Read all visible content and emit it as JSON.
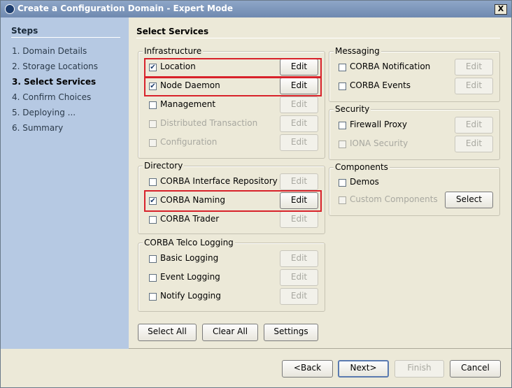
{
  "window": {
    "title": "Create a Configuration Domain - Expert Mode",
    "close_label": "X"
  },
  "steps": {
    "title": "Steps",
    "items": [
      "1. Domain Details",
      "2. Storage Locations",
      "3. Select Services",
      "4. Confirm Choices",
      "5. Deploying ...",
      "6. Summary"
    ]
  },
  "content": {
    "title": "Select Services"
  },
  "infrastructure": {
    "label": "Infrastructure",
    "items": [
      {
        "label": "Location",
        "checked": true,
        "enabled": true,
        "button": "Edit"
      },
      {
        "label": "Node Daemon",
        "checked": true,
        "enabled": true,
        "button": "Edit"
      },
      {
        "label": "Management",
        "checked": false,
        "enabled": true,
        "button": "Edit"
      },
      {
        "label": "Distributed Transaction",
        "checked": false,
        "enabled": false,
        "button": "Edit"
      },
      {
        "label": "Configuration",
        "checked": false,
        "enabled": false,
        "button": "Edit"
      }
    ]
  },
  "directory": {
    "label": "Directory",
    "items": [
      {
        "label": "CORBA Interface Repository",
        "checked": false,
        "enabled": true,
        "button": "Edit"
      },
      {
        "label": "CORBA Naming",
        "checked": true,
        "enabled": true,
        "button": "Edit"
      },
      {
        "label": "CORBA Trader",
        "checked": false,
        "enabled": true,
        "button": "Edit"
      }
    ]
  },
  "telco": {
    "label": "CORBA Telco Logging",
    "items": [
      {
        "label": "Basic Logging",
        "checked": false,
        "enabled": true,
        "button": "Edit"
      },
      {
        "label": "Event Logging",
        "checked": false,
        "enabled": true,
        "button": "Edit"
      },
      {
        "label": "Notify Logging",
        "checked": false,
        "enabled": true,
        "button": "Edit"
      }
    ]
  },
  "messaging": {
    "label": "Messaging",
    "items": [
      {
        "label": "CORBA Notification",
        "checked": false,
        "enabled": true,
        "button": "Edit"
      },
      {
        "label": "CORBA Events",
        "checked": false,
        "enabled": true,
        "button": "Edit"
      }
    ]
  },
  "security": {
    "label": "Security",
    "items": [
      {
        "label": "Firewall Proxy",
        "checked": false,
        "enabled": true,
        "button": "Edit"
      },
      {
        "label": "IONA Security",
        "checked": false,
        "enabled": false,
        "button": "Edit"
      }
    ]
  },
  "components": {
    "label": "Components",
    "items": [
      {
        "label": "Demos",
        "checked": false,
        "enabled": true
      },
      {
        "label": "Custom Components",
        "checked": false,
        "enabled": false,
        "button": "Select"
      }
    ]
  },
  "actions": {
    "select_all": "Select All",
    "clear_all": "Clear All",
    "settings": "Settings"
  },
  "nav": {
    "back": "<Back",
    "next": "Next>",
    "finish": "Finish",
    "cancel": "Cancel"
  }
}
